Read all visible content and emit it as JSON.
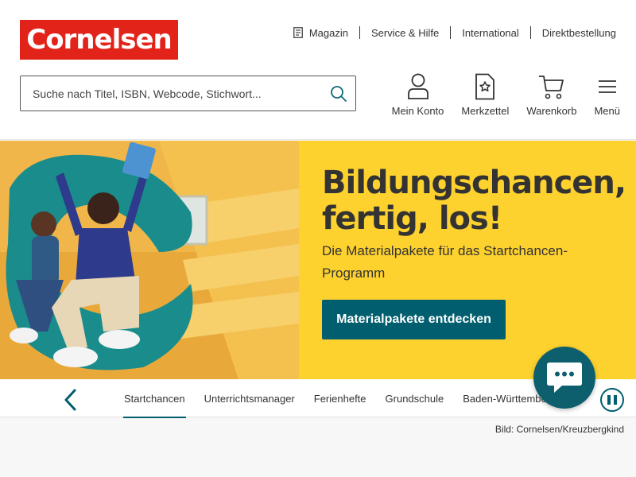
{
  "brand": {
    "logo_text": "Cornelsen",
    "color": "#e2231a"
  },
  "topnav": {
    "items": [
      {
        "label": "Magazin",
        "icon": "magazine-icon"
      },
      {
        "label": "Service & Hilfe"
      },
      {
        "label": "International"
      },
      {
        "label": "Direktbestellung"
      }
    ]
  },
  "search": {
    "placeholder": "Suche nach Titel, ISBN, Webcode, Stichwort...",
    "value": ""
  },
  "actions": [
    {
      "label": "Mein Konto",
      "icon": "user-icon"
    },
    {
      "label": "Merkzettel",
      "icon": "bookmark-star-icon"
    },
    {
      "label": "Warenkorb",
      "icon": "cart-icon"
    },
    {
      "label": "Menü",
      "icon": "hamburger-menu-icon"
    }
  ],
  "hero": {
    "title_line1": "Bildungschancen,",
    "title_line2": "fertig, los!",
    "subtitle": "Die Materialpakete für das Startchancen-Programm",
    "cta_label": "Materialpakete entdecken",
    "bg_color": "#fdd12e",
    "cta_color": "#005e6e"
  },
  "carousel_tabs": {
    "items": [
      "Startchancen",
      "Unterrichtsmanager",
      "Ferienhefte",
      "Grundschule",
      "Baden-Württemberg"
    ],
    "active_index": 0
  },
  "image_credit": "Bild: Cornelsen/Kreuzbergkind"
}
